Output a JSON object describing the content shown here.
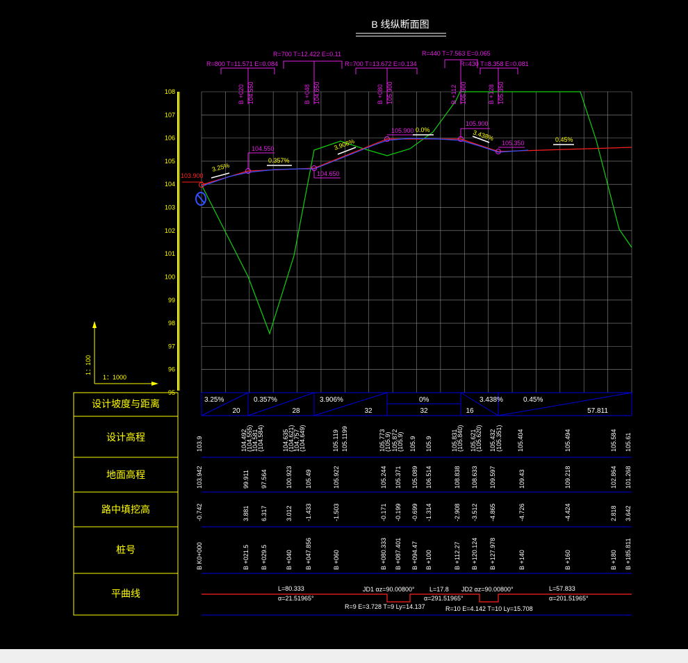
{
  "title": "B 线纵断面图",
  "scale": {
    "vertical": "1：100",
    "horizontal": "1：1000"
  },
  "y_ticks": [
    "108",
    "107",
    "106",
    "105",
    "104",
    "103",
    "102",
    "101",
    "100",
    "99",
    "98",
    "97",
    "96",
    "95"
  ],
  "vc_labels": [
    "R=800 T=11.571 E=0.084",
    "R=700 T=12.422 E=0.11",
    "R=700 T=13.672 E=0.134",
    "R=440 T=7.563 E=0.065",
    "R=430 T=8.358 E=0.081"
  ],
  "pvi_stations": [
    [
      "B +020",
      "104.550"
    ],
    [
      "B +048",
      "104.650"
    ],
    [
      "B +080",
      "105.900"
    ],
    [
      "B +112",
      "105.900"
    ],
    [
      "B +128",
      "105.350"
    ]
  ],
  "elevation_labels": {
    "start": "103.900",
    "p1": "104.550",
    "p2": "104.650",
    "p3": "105.900",
    "p4": "105.900",
    "p5": "105.350"
  },
  "grade_labels_profile": [
    "3.25%",
    "0.357%",
    "3.906%",
    "0.0%",
    "3.438%",
    "0.45%"
  ],
  "table": {
    "row_titles": [
      "设计坡度与距离",
      "设计高程",
      "地面高程",
      "路中填挖高",
      "桩号",
      "平曲线"
    ],
    "grades": [
      "3.25%",
      "0.357%",
      "3.906%",
      "0%",
      "3.438%",
      "0.45%"
    ],
    "distances": [
      "20",
      "28",
      "32",
      "32",
      "16",
      "57.811"
    ],
    "design_elev": [
      "103.9",
      "104.492",
      "(104.555)",
      "104.581",
      "(104.584)",
      "104.635",
      "(104.621)",
      "104.757",
      "(104.649)",
      "105.119",
      "105.1199",
      "105.773",
      "(105.9)",
      "105.872",
      "(105.9)",
      "105.9",
      "105.9",
      "105.831",
      "(105.840)",
      "105.621",
      "(105.620)",
      "105.432",
      "(105.351)",
      "105.404",
      "105.494",
      "105.584",
      "105.61"
    ],
    "ground_elev": [
      "103.942",
      "99.911",
      "97.564",
      "100.923",
      "105.49",
      "105.922",
      "105.244",
      "105.371",
      "105.089",
      "106.514",
      "108.838",
      "108.633",
      "109.597",
      "109.43",
      "109.218",
      "102.864",
      "101.268"
    ],
    "fill_cut": [
      "-0.742",
      "3.881",
      "6.317",
      "3.012",
      "-1.433",
      "-1.503",
      "-0.171",
      "-0.199",
      "-0.699",
      "-1.314",
      "-2.908",
      "-3.512",
      "-4.865",
      "-4.726",
      "-4.424",
      "2.818",
      "3.642"
    ],
    "stations": [
      "B K0+000",
      "B +021.5",
      "B +029.5",
      "B +040",
      "B +047.856",
      "B +060",
      "B +080.333",
      "B +087.401",
      "B +094.47",
      "B +100",
      "B +112.27",
      "B +120.124",
      "B +127.978",
      "B +140",
      "B +160",
      "B +180",
      "B +185.811"
    ],
    "curve": {
      "L1": "L=80.333",
      "a1": "α=21.51965°",
      "JD1": "JD1  αz=90.00800°",
      "JD1b": "R=9  E=3.728  T=9  Ly=14.137",
      "L2": "L=17.8",
      "a2": "α=291.51965°",
      "JD2": "JD2  αz=90.00800°",
      "JD2b": "R=10  E=4.142  T=10  Ly=15.708",
      "L3": "L=57.833",
      "a3": "α=201.51965°"
    }
  },
  "colors": {
    "grid": "#8c8c8c",
    "design": "#ff2020",
    "design_blue": "#3050ff",
    "ground": "#10d010",
    "annot": "#e020e0",
    "yellow": "#ffff00",
    "white": "#ffffff",
    "table_line": "#0000e0"
  }
}
